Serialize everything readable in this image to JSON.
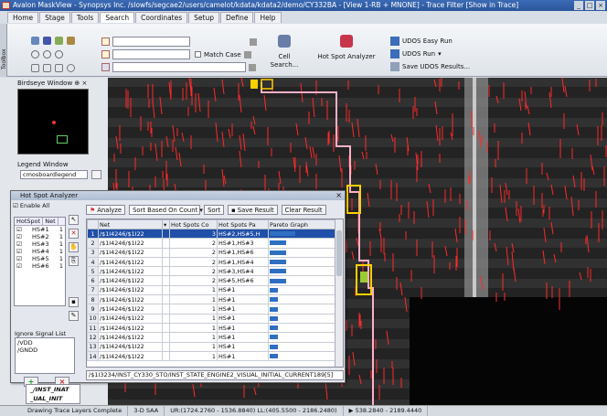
{
  "window": {
    "title": "Avalon MaskView - Synopsys Inc. /slowfs/segcae2/users/camelot/kdata/kdata2/demo/CY332BA - [View 1-RB + MNONE] - Trace Filter [Show in Trace]",
    "min": "_",
    "max": "□",
    "close": "×"
  },
  "menu": [
    "Home",
    "Stage",
    "Tools",
    "Search",
    "Coordinates",
    "Setup",
    "Define",
    "Help"
  ],
  "ribbon": {
    "toolbox_label": "Toolbox",
    "match_case": "Match Case",
    "cell_search": "Cell Search...",
    "hot_spot_analyzer": "Hot Spot Analyzer",
    "udos_easy_run": "UDOS Easy Run",
    "udos_run": "UDOS Run",
    "save_udos": "Save UDOS Results..."
  },
  "panels": {
    "birdseye": "Birdseye Window",
    "legend": "Legend Window",
    "legend_select": "cmosboardlegend"
  },
  "hsa": {
    "title": "Hot Spot Analyzer",
    "enable_all": "Enable All",
    "hotspot_header": "HotSpot",
    "net_header": "Net",
    "hotspots": [
      {
        "name": "HS#1",
        "count": "1"
      },
      {
        "name": "HS#2",
        "count": "1"
      },
      {
        "name": "HS#3",
        "count": "1"
      },
      {
        "name": "HS#4",
        "count": "1"
      },
      {
        "name": "HS#5",
        "count": "1"
      },
      {
        "name": "HS#6",
        "count": "1"
      }
    ],
    "ignore_title": "Ignore Signal List",
    "ignore_list": [
      "/VDD",
      "/GNDD"
    ],
    "add": "+",
    "remove": "×",
    "analyze": "Analyze",
    "sort_select": "Sort Based On Count",
    "sort": "Sort",
    "save_result": "Save Result",
    "clear_result": "Clear Result",
    "columns": [
      "Net",
      "Hot Spots Co",
      "Hot Spots Pa",
      "Pareto Graph"
    ],
    "rows": [
      {
        "n": "1",
        "net": "/$1I4246/$1I22",
        "count": "3",
        "spots": "HS#2,HS#5,H",
        "pct": 1.0
      },
      {
        "n": "2",
        "net": "/$1I4246/$1I22",
        "count": "2",
        "spots": "HS#1,HS#3",
        "pct": 0.66
      },
      {
        "n": "3",
        "net": "/$1I4246/$1I22",
        "count": "2",
        "spots": "HS#1,HS#6",
        "pct": 0.66
      },
      {
        "n": "4",
        "net": "/$1I4246/$1I22",
        "count": "2",
        "spots": "HS#1,HS#4",
        "pct": 0.66
      },
      {
        "n": "5",
        "net": "/$1I4246/$1I22",
        "count": "2",
        "spots": "HS#3,HS#4",
        "pct": 0.66
      },
      {
        "n": "6",
        "net": "/$1I4246/$1I22",
        "count": "2",
        "spots": "HS#5,HS#6",
        "pct": 0.66
      },
      {
        "n": "7",
        "net": "/$1I4246/$1I22",
        "count": "1",
        "spots": "HS#1",
        "pct": 0.33
      },
      {
        "n": "8",
        "net": "/$1I4246/$1I22",
        "count": "1",
        "spots": "HS#1",
        "pct": 0.33
      },
      {
        "n": "9",
        "net": "/$1I4246/$1I22",
        "count": "1",
        "spots": "HS#1",
        "pct": 0.33
      },
      {
        "n": "10",
        "net": "/$1I4246/$1I22",
        "count": "1",
        "spots": "HS#1",
        "pct": 0.33
      },
      {
        "n": "11",
        "net": "/$1I4246/$1I22",
        "count": "1",
        "spots": "HS#1",
        "pct": 0.33
      },
      {
        "n": "12",
        "net": "/$1I4246/$1I22",
        "count": "1",
        "spots": "HS#1",
        "pct": 0.33
      },
      {
        "n": "13",
        "net": "/$1I4246/$1I22",
        "count": "1",
        "spots": "HS#1",
        "pct": 0.33
      },
      {
        "n": "14",
        "net": "/$1I4246/$1I22",
        "count": "1",
        "spots": "HS#1",
        "pct": 0.33
      }
    ],
    "net_status": "/$1I3234/INST_CY330_STO/INST_STATE_ENGINE2_VISUAL_INITIAL_CURRENT189[5]"
  },
  "legend_bottom": [
    "_/INST_INAT",
    "_UAL_INIT"
  ],
  "status": [
    "Drawing Trace Layers Complete",
    "3-D SAA",
    "UR:(1724.2760 - 1536.8840) LL:(405.5500 - 2186.2480)",
    "▶ 538.2840 - 2189.4440"
  ],
  "colors": {
    "trace": "#ff2a2a",
    "highlight": "#ffd000",
    "net_path": "#ffb0c8",
    "selection": "#1f4fa8",
    "pareto_bar": "#2e6fc2"
  }
}
